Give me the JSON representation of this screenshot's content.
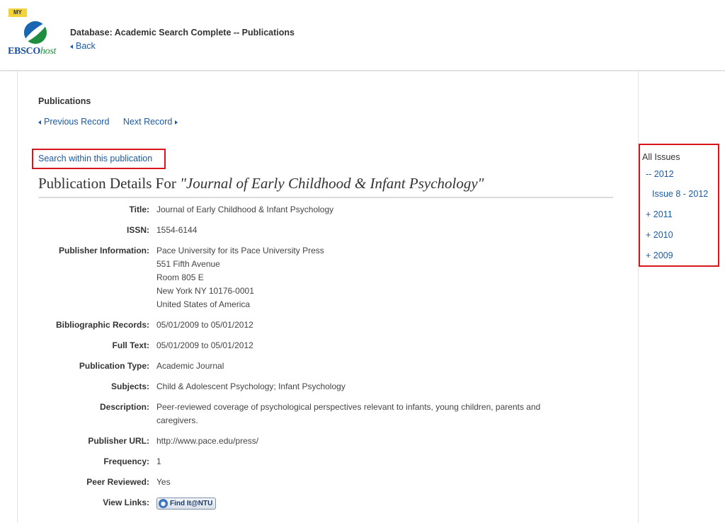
{
  "header": {
    "my_badge": "MY",
    "logo_main": "EBSCO",
    "logo_host": "host",
    "database_title": "Database: Academic Search Complete -- Publications",
    "back_label": "Back"
  },
  "nav": {
    "section_title": "Publications",
    "previous_label": "Previous Record",
    "next_label": "Next Record"
  },
  "search_within_label": "Search within this publication",
  "heading": {
    "prefix": "Publication Details For ",
    "journal": "\"Journal of Early Childhood & Infant Psychology\""
  },
  "details": {
    "title": {
      "label": "Title:",
      "value": "Journal of Early Childhood & Infant Psychology"
    },
    "issn": {
      "label": "ISSN:",
      "value": "1554-6144"
    },
    "publisher": {
      "label": "Publisher Information:",
      "lines": [
        "Pace University for its Pace University Press",
        "551 Fifth Avenue",
        "Room 805 E",
        "New York NY 10176-0001",
        "United States of America"
      ]
    },
    "bibliographic": {
      "label": "Bibliographic Records:",
      "value": "05/01/2009 to 05/01/2012"
    },
    "full_text": {
      "label": "Full Text:",
      "value": "05/01/2009 to 05/01/2012"
    },
    "publication_type": {
      "label": "Publication Type:",
      "value": "Academic Journal"
    },
    "subjects": {
      "label": "Subjects:",
      "value": "Child & Adolescent Psychology; Infant Psychology"
    },
    "description": {
      "label": "Description:",
      "lines": [
        "Peer-reviewed coverage of psychological perspectives relevant to infants, young children, parents and",
        "caregivers."
      ]
    },
    "publisher_url": {
      "label": "Publisher URL:",
      "value": "http://www.pace.edu/press/"
    },
    "frequency": {
      "label": "Frequency:",
      "value": "1"
    },
    "peer_reviewed": {
      "label": "Peer Reviewed:",
      "value": "Yes"
    },
    "view_links": {
      "label": "View Links:",
      "button": "Find It@NTU"
    }
  },
  "issues": {
    "title": "All Issues",
    "items": [
      "-- 2012",
      "Issue 8 - 2012",
      "+ 2011",
      "+ 2010",
      "+ 2009"
    ]
  },
  "colors": {
    "link": "#1a5aa6",
    "highlight_box": "#d9141b"
  }
}
